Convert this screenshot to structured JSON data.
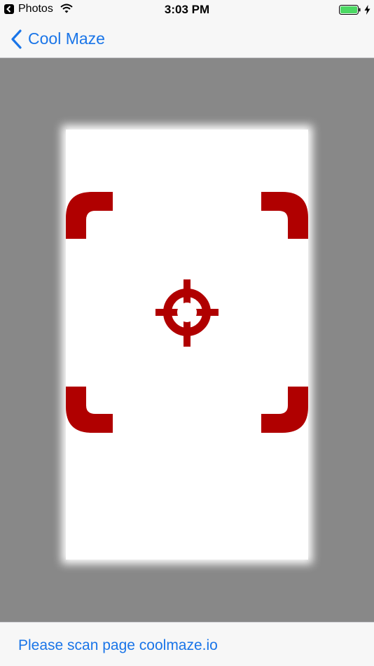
{
  "status_bar": {
    "back_app": "Photos",
    "time": "3:03 PM",
    "icons": [
      "back-arrow-icon",
      "wifi-icon",
      "battery-icon",
      "charging-bolt-icon"
    ],
    "battery_level": 1.0,
    "battery_color": "#4cd964"
  },
  "nav": {
    "back_label": "Cool Maze",
    "accent_color": "#1a75e8"
  },
  "scanner": {
    "frame_color": "#b00000",
    "icons": [
      "corner-bracket-icon",
      "crosshair-icon"
    ]
  },
  "footer": {
    "instruction": "Please scan page coolmaze.io"
  }
}
